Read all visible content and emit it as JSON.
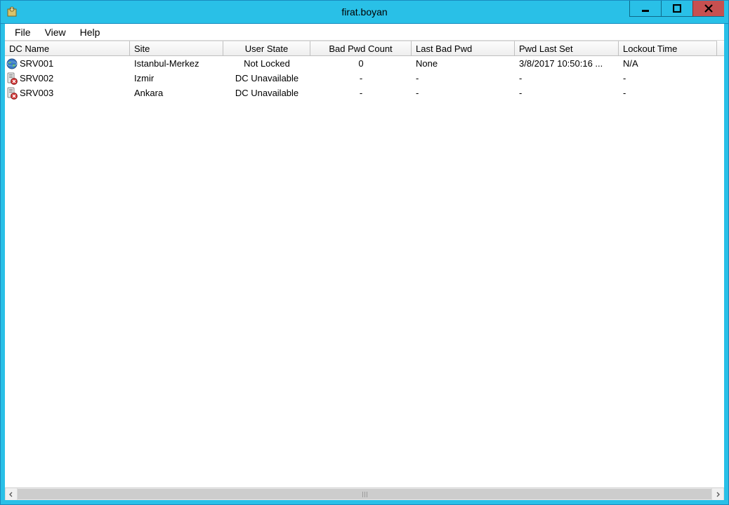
{
  "window": {
    "title": "firat.boyan"
  },
  "menu": {
    "file": "File",
    "view": "View",
    "help": "Help"
  },
  "columns": {
    "dcname": "DC Name",
    "site": "Site",
    "userstate": "User State",
    "badpwdcount": "Bad Pwd Count",
    "lastbadpwd": "Last Bad Pwd",
    "pwdlastset": "Pwd Last Set",
    "lockouttime": "Lockout Time"
  },
  "rows": [
    {
      "icon": "globe",
      "dcname": "SRV001",
      "site": "Istanbul-Merkez",
      "userstate": "Not Locked",
      "badpwdcount": "0",
      "lastbadpwd": "None",
      "pwdlastset": "3/8/2017 10:50:16 ...",
      "lockouttime": "N/A"
    },
    {
      "icon": "srv-err",
      "dcname": "SRV002",
      "site": "Izmir",
      "userstate": "DC Unavailable",
      "badpwdcount": "-",
      "lastbadpwd": "-",
      "pwdlastset": "-",
      "lockouttime": "-"
    },
    {
      "icon": "srv-err",
      "dcname": "SRV003",
      "site": "Ankara",
      "userstate": "DC Unavailable",
      "badpwdcount": "-",
      "lastbadpwd": "-",
      "pwdlastset": "-",
      "lockouttime": "-"
    }
  ]
}
